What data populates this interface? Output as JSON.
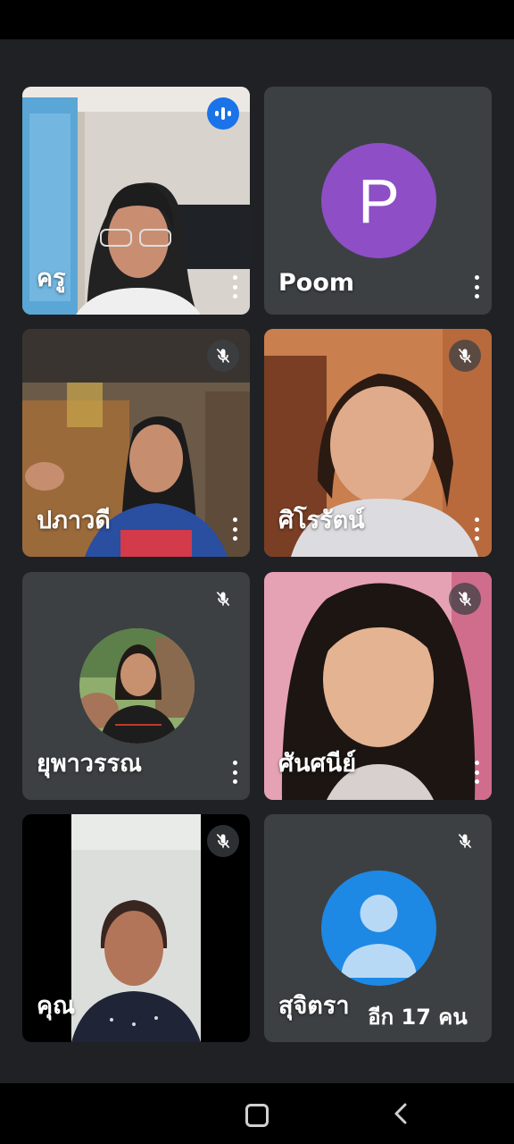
{
  "participants": [
    {
      "name": "ครู",
      "state": "speaking"
    },
    {
      "name": "Poom",
      "avatar_letter": "P",
      "avatar_color": "#8e4ec6"
    },
    {
      "name": "ปภาวดี",
      "state": "muted"
    },
    {
      "name": "ศิโรรัตน์",
      "state": "muted"
    },
    {
      "name": "ยุพาวรรณ",
      "state": "muted"
    },
    {
      "name": "ศันศนีย์",
      "state": "muted"
    },
    {
      "name": "คุณ",
      "state": "muted"
    },
    {
      "name": "สุจิตรา",
      "state": "muted",
      "avatar_color": "#1e88e5"
    }
  ],
  "overflow_label": "อีก 17 คน",
  "icons": {
    "speaking": "speaking-indicator-icon",
    "muted": "mic-off-icon",
    "more": "more-vert-icon",
    "home": "home-icon",
    "back": "back-icon"
  },
  "colors": {
    "background": "#202124",
    "tile": "#3c4043",
    "accent": "#1a73e8"
  }
}
